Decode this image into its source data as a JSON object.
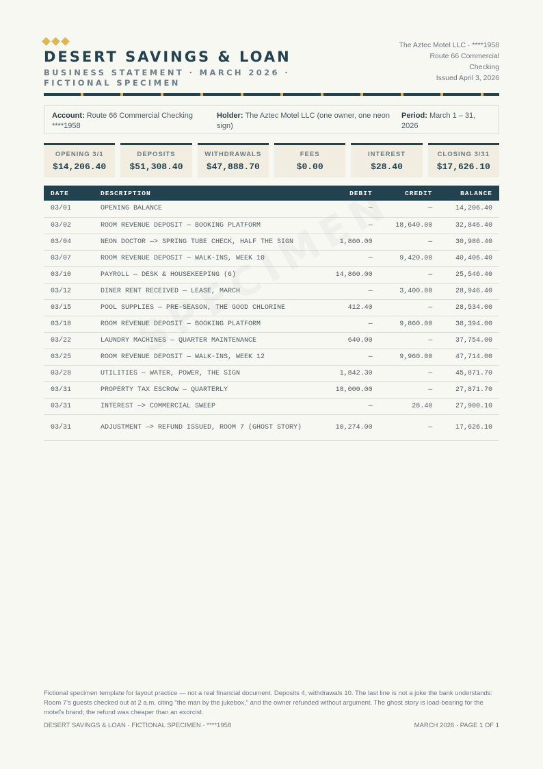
{
  "header": {
    "bank_name": "DESERT SAVINGS & LOAN",
    "subtitle": "BUSINESS STATEMENT · MARCH 2026 · FICTIONAL SPECIMEN",
    "issuer_line1": "The Aztec Motel LLC · ****1958",
    "issuer_line2": "Route 66 Commercial",
    "issuer_line3": "Checking",
    "issued": "Issued April 3, 2026"
  },
  "account": {
    "account_label": "Account:",
    "account_value": "Route 66 Commercial Checking ****1958",
    "holder_label": "Holder:",
    "holder_value": "The Aztec Motel LLC (one owner, one neon sign)",
    "period_label": "Period:",
    "period_value": "March 1 – 31, 2026"
  },
  "summary": [
    {
      "label": "OPENING 3/1",
      "value": "$14,206.40"
    },
    {
      "label": "DEPOSITS",
      "value": "$51,308.40"
    },
    {
      "label": "WITHDRAWALS",
      "value": "$47,888.70"
    },
    {
      "label": "FEES",
      "value": "$0.00"
    },
    {
      "label": "INTEREST",
      "value": "$28.40"
    },
    {
      "label": "CLOSING 3/31",
      "value": "$17,626.10"
    }
  ],
  "table": {
    "headers": {
      "date": "DATE",
      "description": "DESCRIPTION",
      "debit": "DEBIT",
      "credit": "CREDIT",
      "balance": "BALANCE"
    },
    "rows": [
      {
        "date": "03/01",
        "description": "OPENING BALANCE",
        "debit": "—",
        "credit": "—",
        "balance": "14,206.40"
      },
      {
        "date": "03/02",
        "description": "ROOM REVENUE DEPOSIT — BOOKING PLATFORM",
        "debit": "—",
        "credit": "18,640.00",
        "balance": "32,846.40"
      },
      {
        "date": "03/04",
        "description": "NEON DOCTOR —> SPRING TUBE CHECK, HALF THE SIGN",
        "debit": "1,860.00",
        "credit": "—",
        "balance": "30,986.40"
      },
      {
        "date": "03/07",
        "description": "ROOM REVENUE DEPOSIT — WALK-INS, WEEK 10",
        "debit": "—",
        "credit": "9,420.00",
        "balance": "40,406.40"
      },
      {
        "date": "03/10",
        "description": "PAYROLL — DESK & HOUSEKEEPING (6)",
        "debit": "14,860.00",
        "credit": "—",
        "balance": "25,546.40"
      },
      {
        "date": "03/12",
        "description": "DINER RENT RECEIVED — LEASE, MARCH",
        "debit": "—",
        "credit": "3,400.00",
        "balance": "28,946.40"
      },
      {
        "date": "03/15",
        "description": "POOL SUPPLIES — PRE-SEASON, THE GOOD CHLORINE",
        "debit": "412.40",
        "credit": "—",
        "balance": "28,534.00"
      },
      {
        "date": "03/18",
        "description": "ROOM REVENUE DEPOSIT — BOOKING PLATFORM",
        "debit": "—",
        "credit": "9,860.00",
        "balance": "38,394.00"
      },
      {
        "date": "03/22",
        "description": "LAUNDRY MACHINES — QUARTER MAINTENANCE",
        "debit": "640.00",
        "credit": "—",
        "balance": "37,754.00"
      },
      {
        "date": "03/25",
        "description": "ROOM REVENUE DEPOSIT — WALK-INS, WEEK 12",
        "debit": "—",
        "credit": "9,960.00",
        "balance": "47,714.00"
      },
      {
        "date": "03/28",
        "description": "UTILITIES — WATER, POWER, THE SIGN",
        "debit": "1,842.30",
        "credit": "—",
        "balance": "45,871.70"
      },
      {
        "date": "03/31",
        "description": "PROPERTY TAX ESCROW — QUARTERLY",
        "debit": "18,000.00",
        "credit": "—",
        "balance": "27,871.70"
      },
      {
        "date": "03/31",
        "description": "INTEREST —> COMMERCIAL SWEEP",
        "debit": "—",
        "credit": "28.40",
        "balance": "27,900.10"
      },
      {
        "date": "03/31",
        "description": "ADJUSTMENT —> REFUND ISSUED, ROOM 7 (GHOST STORY)",
        "debit": "10,274.00",
        "credit": "—",
        "balance": "17,626.10"
      }
    ]
  },
  "watermark": "SPECIMEN",
  "footer": {
    "note": "Fictional specimen template for layout practice — not a real financial document. Deposits 4, withdrawals 10. The last line is not a joke the bank understands: Room 7's guests checked out at 2 a.m. citing \"the man by the jukebox,\" and the owner refunded without argument. The ghost story is load-bearing for the motel's brand; the refund was cheaper than an exorcist.",
    "left": "DESERT SAVINGS & LOAN · FICTIONAL SPECIMEN · ****1958",
    "right": "MARCH 2026 · PAGE 1 OF 1"
  },
  "colors": {
    "navy": "#22424f",
    "gold": "#e0b64e",
    "debit": "#c4803f",
    "credit": "#5f9e52",
    "paper": "#f8f8f3"
  }
}
